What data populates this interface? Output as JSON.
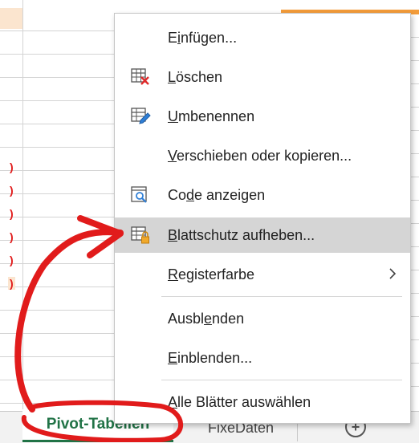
{
  "sheet": {
    "row_markers": [
      ")",
      ")",
      ")",
      ")",
      ")",
      ")"
    ],
    "tabs": [
      {
        "label": "Pivot-Tabellen",
        "active": true
      },
      {
        "label": "FixeDaten",
        "active": false
      }
    ],
    "add_sheet_symbol": "+"
  },
  "menu": {
    "items": [
      {
        "id": "einfuegen",
        "pre": "E",
        "ul": "i",
        "post": "nfügen...",
        "icon": "none"
      },
      {
        "id": "loeschen",
        "pre": "",
        "ul": "L",
        "post": "öschen",
        "icon": "delete-sheet-icon"
      },
      {
        "id": "umbenennen",
        "pre": "",
        "ul": "U",
        "post": "mbenennen",
        "icon": "rename-sheet-icon"
      },
      {
        "id": "verschieben",
        "pre": "",
        "ul": "V",
        "post": "erschieben oder kopieren...",
        "icon": "none"
      },
      {
        "id": "code",
        "pre": "Co",
        "ul": "d",
        "post": "e anzeigen",
        "icon": "view-code-icon"
      },
      {
        "id": "blattschutz",
        "pre": "",
        "ul": "B",
        "post": "lattschutz aufheben...",
        "icon": "unprotect-sheet-icon",
        "hovered": true
      },
      {
        "id": "registerfarbe",
        "pre": "",
        "ul": "R",
        "post": "egisterfarbe",
        "icon": "none",
        "submenu": true
      },
      {
        "id": "ausblenden",
        "pre": "Ausbl",
        "ul": "e",
        "post": "nden",
        "icon": "none"
      },
      {
        "id": "einblenden",
        "pre": "",
        "ul": "E",
        "post": "inblenden...",
        "icon": "none"
      },
      {
        "id": "alle",
        "pre": "",
        "ul": "A",
        "post": "lle Blätter auswählen",
        "icon": "none"
      }
    ]
  },
  "colors": {
    "accent_green": "#217346",
    "annotation_red": "#e11b1b",
    "hover_gray": "#d5d5d5",
    "header_orange": "#f39c3a"
  }
}
